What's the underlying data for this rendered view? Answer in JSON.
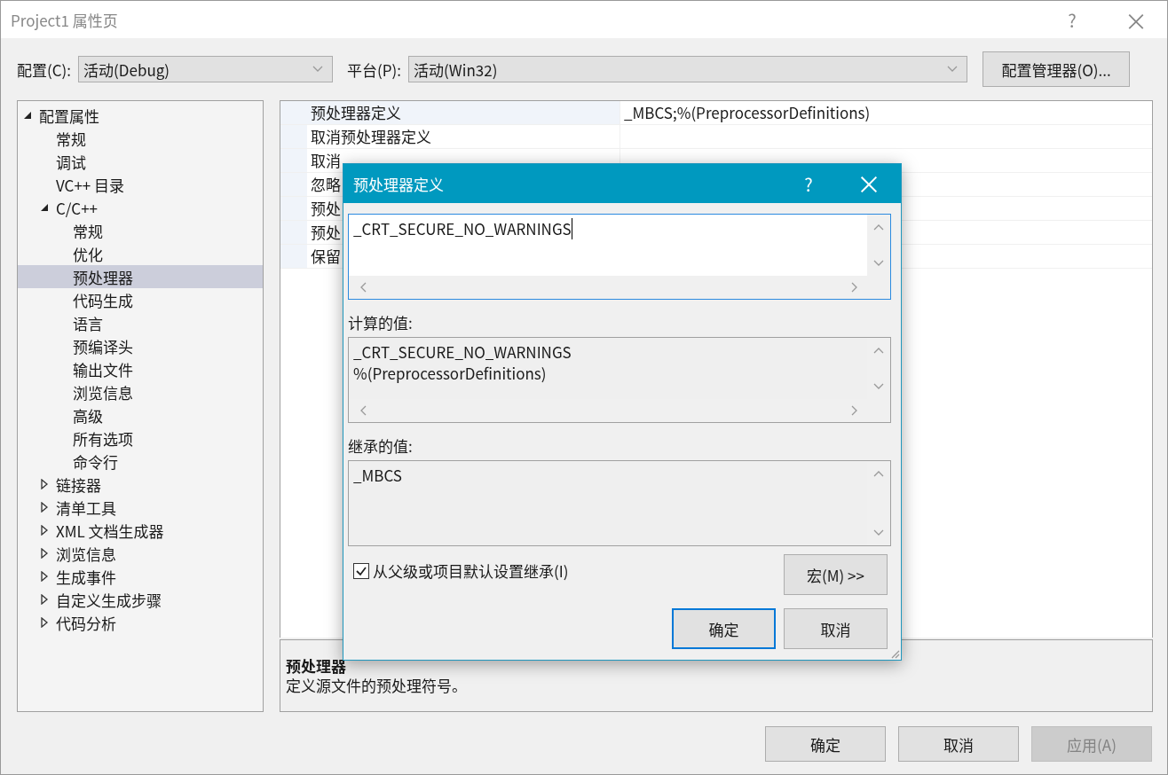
{
  "window": {
    "title": "Project1 属性页",
    "help": "?",
    "close": "×"
  },
  "config_bar": {
    "config_label": "配置(C):",
    "config_value": "活动(Debug)",
    "platform_label": "平台(P):",
    "platform_value": "活动(Win32)",
    "manager_button": "配置管理器(O)..."
  },
  "tree": [
    {
      "label": "配置属性",
      "expanded": true,
      "selected": false,
      "children": [
        {
          "label": "常规",
          "selected": false
        },
        {
          "label": "调试",
          "selected": false
        },
        {
          "label": "VC++ 目录",
          "selected": false
        },
        {
          "label": "C/C++",
          "expanded": true,
          "selected": false,
          "children": [
            {
              "label": "常规",
              "selected": false
            },
            {
              "label": "优化",
              "selected": false
            },
            {
              "label": "预处理器",
              "selected": true
            },
            {
              "label": "代码生成",
              "selected": false
            },
            {
              "label": "语言",
              "selected": false
            },
            {
              "label": "预编译头",
              "selected": false
            },
            {
              "label": "输出文件",
              "selected": false
            },
            {
              "label": "浏览信息",
              "selected": false
            },
            {
              "label": "高级",
              "selected": false
            },
            {
              "label": "所有选项",
              "selected": false
            },
            {
              "label": "命令行",
              "selected": false
            }
          ]
        },
        {
          "label": "链接器",
          "expanded": false,
          "selected": false
        },
        {
          "label": "清单工具",
          "expanded": false,
          "selected": false
        },
        {
          "label": "XML 文档生成器",
          "expanded": false,
          "selected": false
        },
        {
          "label": "浏览信息",
          "expanded": false,
          "selected": false
        },
        {
          "label": "生成事件",
          "expanded": false,
          "selected": false
        },
        {
          "label": "自定义生成步骤",
          "expanded": false,
          "selected": false
        },
        {
          "label": "代码分析",
          "expanded": false,
          "selected": false
        }
      ]
    }
  ],
  "properties": [
    {
      "name": "预处理器定义",
      "value": "_MBCS;%(PreprocessorDefinitions)",
      "selected": true
    },
    {
      "name": "取消预处理器定义",
      "selected": false
    },
    {
      "name": "取消",
      "selected": false
    },
    {
      "name": "忽略",
      "selected": false
    },
    {
      "name": "预处",
      "selected": false
    },
    {
      "name": "预处",
      "selected": false
    },
    {
      "name": "保留",
      "selected": false
    }
  ],
  "description": {
    "title": "预处理器",
    "text": "定义源文件的预处理符号。"
  },
  "buttons": [
    {
      "label": "确定",
      "disabled": false
    },
    {
      "label": "取消",
      "disabled": false
    },
    {
      "label": "应用(A)",
      "disabled": true
    }
  ],
  "dialog": {
    "title": "预处理器定义",
    "help": "?",
    "close": "×",
    "input_value": "_CRT_SECURE_NO_WARNINGS",
    "evaluated_label": "计算的值:",
    "evaluated_lines": [
      "_CRT_SECURE_NO_WARNINGS",
      "%(PreprocessorDefinitions)"
    ],
    "inherited_label": "继承的值:",
    "inherited_lines": [
      "_MBCS"
    ],
    "inherit_checkbox": {
      "label": "从父级或项目默认设置继承(I)",
      "checked": true
    },
    "macro_button": "宏(M) >>",
    "buttons": [
      {
        "label": "确定",
        "default": true
      },
      {
        "label": "取消",
        "default": false
      }
    ]
  }
}
